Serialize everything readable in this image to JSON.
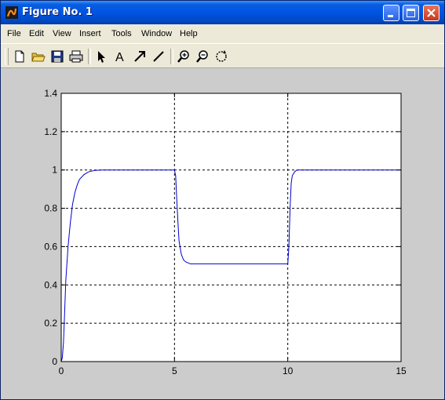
{
  "window": {
    "title": "Figure No. 1"
  },
  "menu": [
    "File",
    "Edit",
    "View",
    "Insert",
    "Tools",
    "Window",
    "Help"
  ],
  "toolbar": {
    "tools": [
      "new-file-icon",
      "open-folder-icon",
      "save-icon",
      "print-icon",
      "arrow-select-icon",
      "insert-text-icon",
      "insert-arrow-icon",
      "insert-line-icon",
      "zoom-in-icon",
      "zoom-out-icon",
      "rotate-icon"
    ]
  },
  "chart_data": {
    "type": "line",
    "title": "",
    "xlabel": "",
    "ylabel": "",
    "xlim": [
      0,
      15
    ],
    "ylim": [
      0,
      1.4
    ],
    "xticks": [
      "0",
      "5",
      "10",
      "15"
    ],
    "yticks": [
      "0",
      "0.2",
      "0.4",
      "0.6",
      "0.8",
      "1",
      "1.2",
      "1.4"
    ],
    "grid": true,
    "series": [
      {
        "color": "#0000cc",
        "x": [
          0,
          0.05,
          0.1,
          0.15,
          0.2,
          0.3,
          0.4,
          0.5,
          0.6,
          0.7,
          0.8,
          1.0,
          1.2,
          1.5,
          1.8,
          5.0,
          5.05,
          5.1,
          5.15,
          5.2,
          5.3,
          5.4,
          5.5,
          5.7,
          5.9,
          6.2,
          10.0,
          10.05,
          10.1,
          10.15,
          10.2,
          10.3,
          10.4,
          10.5,
          10.7,
          15
        ],
        "y": [
          0,
          0.02,
          0.1,
          0.25,
          0.42,
          0.6,
          0.72,
          0.82,
          0.88,
          0.92,
          0.95,
          0.975,
          0.99,
          0.998,
          1.0,
          1.0,
          0.97,
          0.85,
          0.73,
          0.63,
          0.56,
          0.53,
          0.52,
          0.51,
          0.51,
          0.51,
          0.51,
          0.6,
          0.8,
          0.93,
          0.97,
          0.99,
          1.0,
          1.0,
          1.0,
          1.0
        ]
      }
    ]
  }
}
